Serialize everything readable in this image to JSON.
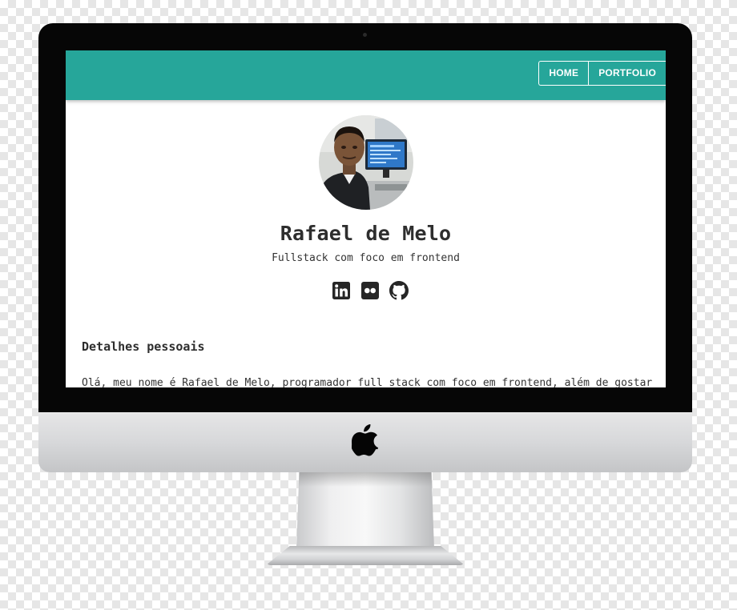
{
  "site": {
    "header_color": "#26a69a",
    "nav": [
      {
        "label": "HOME"
      },
      {
        "label": "PORTFOLIO"
      }
    ]
  },
  "profile": {
    "name": "Rafael de Melo",
    "tagline": "Fullstack com foco em frontend",
    "avatar_icon": "profile-photo",
    "social": [
      {
        "icon": "linkedin-icon"
      },
      {
        "icon": "flickr-icon"
      },
      {
        "icon": "github-icon"
      }
    ]
  },
  "details": {
    "title": "Detalhes pessoais",
    "intro": "Olá, meu nome é Rafael de Melo, programador full stack com foco em frontend, além de gostar"
  },
  "device": {
    "brand_icon": "apple-logo-icon",
    "bezel_color": "#060606"
  }
}
